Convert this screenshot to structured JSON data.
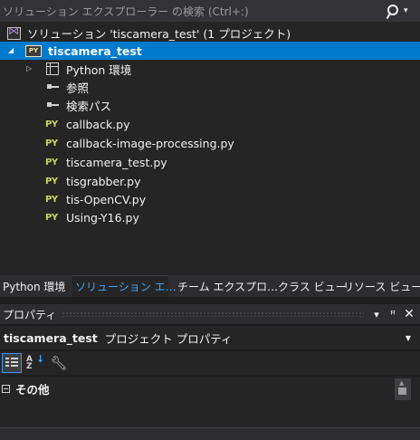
{
  "search": {
    "placeholder": "ソリューション エクスプローラー の検索 (Ctrl+:)"
  },
  "solution": {
    "label": "ソリューション 'tiscamera_test' (1 プロジェクト)"
  },
  "project": {
    "name": "tiscamera_test",
    "icon_text": "PY"
  },
  "tree_items": {
    "environment": "Python 環境",
    "references": "参照",
    "search_paths": "検索パス",
    "py_badge": "PY",
    "files": [
      "callback.py",
      "callback-image-processing.py",
      "tiscamera_test.py",
      "tisgrabber.py",
      "tis-OpenCV.py",
      "Using-Y16.py"
    ]
  },
  "tabs": [
    {
      "label": "Python 環境",
      "active": false
    },
    {
      "label": "ソリューション エ…",
      "active": true
    },
    {
      "label": "チーム エクスプロ…",
      "active": false
    },
    {
      "label": "クラス ビュー",
      "active": false
    },
    {
      "label": "リソース ビュー",
      "active": false
    }
  ],
  "properties": {
    "title": "プロパティ",
    "header_buttons": {
      "dropdown": "▾",
      "pin": "ꟸ",
      "close": "✕"
    },
    "object_name": "tiscamera_test",
    "object_type": "プロジェクト プロパティ",
    "category": "その他"
  },
  "colors": {
    "accent": "#007acc",
    "active_tab_text": "#3ea6ff",
    "py_icon": "#c8d560",
    "background": "#252526"
  }
}
